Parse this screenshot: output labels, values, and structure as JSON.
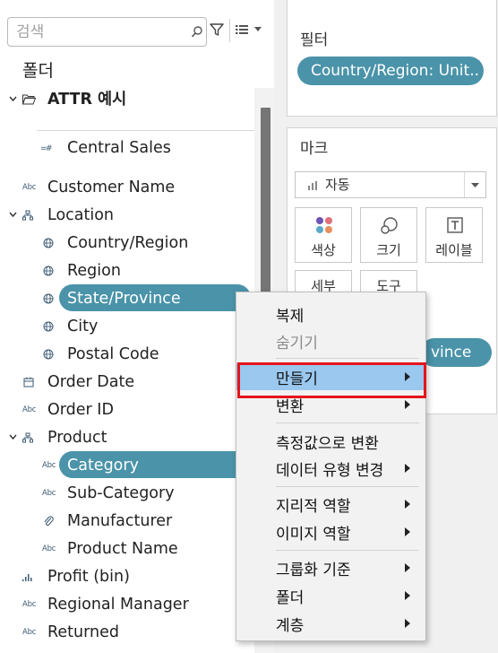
{
  "data_pane": {
    "search": {
      "placeholder": "검색",
      "value": ""
    },
    "folder_heading": "폴더",
    "datasource": {
      "name": "ATTR 예시"
    },
    "fields": {
      "central_sales": "Central Sales",
      "customer_name": "Customer Name",
      "location": "Location",
      "country_region": "Country/Region",
      "region": "Region",
      "state_province": "State/Province",
      "city": "City",
      "postal_code": "Postal Code",
      "order_date": "Order Date",
      "order_id": "Order ID",
      "product": "Product",
      "category": "Category",
      "sub_category": "Sub-Category",
      "manufacturer": "Manufacturer",
      "product_name": "Product Name",
      "profit_bin": "Profit (bin)",
      "regional_manager": "Regional Manager",
      "returned": "Returned"
    },
    "type_badge": "Abc"
  },
  "filters_shelf": {
    "title": "필터",
    "pill": "Country/Region: Unit.."
  },
  "marks_card": {
    "title": "마크",
    "mark_type": "자동",
    "buttons": {
      "color": "색상",
      "size": "크기",
      "label": "레이블",
      "detail": "세부",
      "tooltip": "도구"
    },
    "partial_pill": "vince"
  },
  "context_menu": {
    "duplicate": "복제",
    "hide": "숨기기",
    "create": "만들기",
    "transform": "변환",
    "convert_to_measure": "측정값으로 변환",
    "change_data_type": "데이터 유형 변경",
    "geographic_role": "지리적 역할",
    "image_role": "이미지 역할",
    "group_by": "그룹화 기준",
    "folders": "폴더",
    "hierarchy": "계층"
  },
  "colors": {
    "selection_pill": "#4a93a9",
    "menu_highlight": "#9ac8ef",
    "highlight_outline": "#e4141b",
    "scrollbar_thumb": "#757575"
  }
}
